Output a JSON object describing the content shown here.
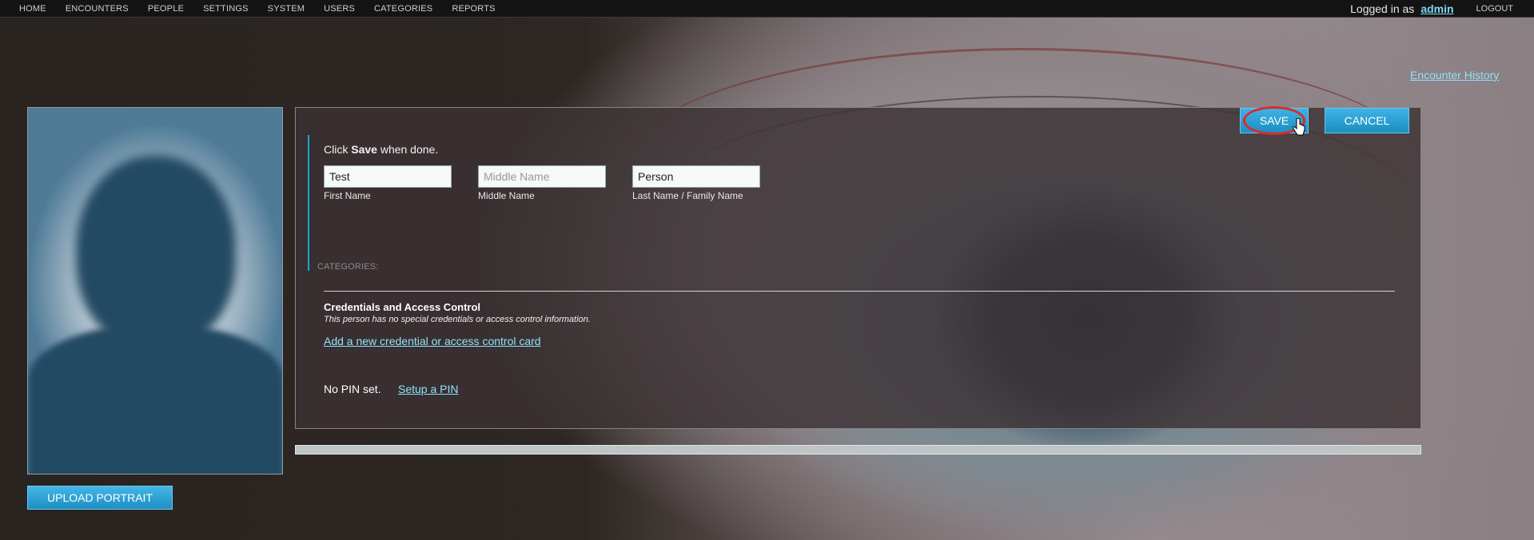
{
  "nav": {
    "items": [
      "HOME",
      "ENCOUNTERS",
      "PEOPLE",
      "SETTINGS",
      "SYSTEM",
      "USERS",
      "CATEGORIES",
      "REPORTS"
    ],
    "logged_in_prefix": "Logged in as",
    "username": "admin",
    "logout": "LOGOUT"
  },
  "header": {
    "history_link": "Encounter History"
  },
  "portrait": {
    "upload_label": "UPLOAD PORTRAIT"
  },
  "actions": {
    "save_label": "SAVE",
    "cancel_label": "CANCEL"
  },
  "form": {
    "instructions_prefix": "Click ",
    "instructions_bold": "Save",
    "instructions_suffix": " when done.",
    "first_name": {
      "value": "Test",
      "label": "First Name"
    },
    "middle_name": {
      "value": "",
      "placeholder": "Middle Name",
      "label": "Middle Name"
    },
    "last_name": {
      "value": "Person",
      "label": "Last Name / Family Name"
    },
    "categories_label": "CATEGORIES:"
  },
  "credentials": {
    "title": "Credentials and Access Control",
    "description": "This person has no special credentials or access control information.",
    "add_link": "Add a new credential or access control card"
  },
  "pin": {
    "status": "No PIN set.",
    "setup_link": "Setup a PIN"
  },
  "progress": {
    "fraction": 1.0
  },
  "colors": {
    "accent": "#19a6d6",
    "button": "#2aa0d4",
    "link": "#8fe2f7",
    "highlight_ring": "#e0282a"
  }
}
